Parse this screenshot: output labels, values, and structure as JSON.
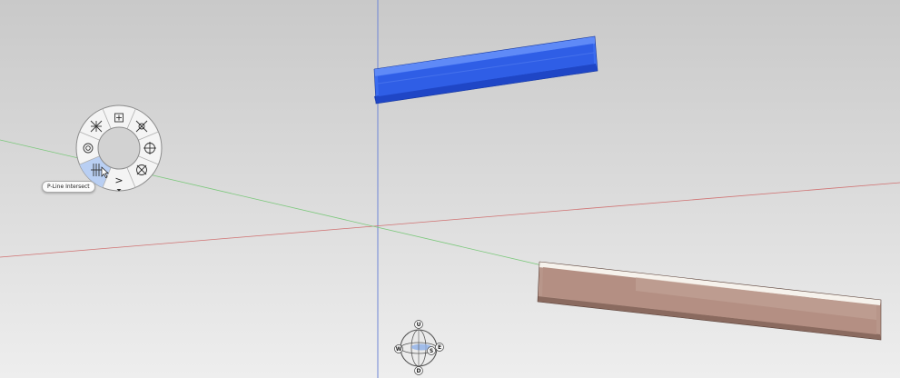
{
  "viewport": {
    "axis_colors": {
      "vertical": "#6f86d6",
      "red": "#d07272",
      "green": "#7bc87b"
    },
    "beams": [
      {
        "name": "blue-i-beam",
        "color": "#2f5ee6"
      },
      {
        "name": "brown-i-beam",
        "color": "#b8968a"
      }
    ]
  },
  "snap_wheel": {
    "items": [
      {
        "name": "center-snap-icon"
      },
      {
        "name": "tangent-snap-icon"
      },
      {
        "name": "quadrant-snap-icon"
      },
      {
        "name": "intersection-snap-icon"
      },
      {
        "name": "next-icon",
        "label": ">"
      },
      {
        "name": "p-line-intersect-icon"
      },
      {
        "name": "concentric-snap-icon"
      },
      {
        "name": "midpoint-snap-icon"
      }
    ],
    "active_item": "p-line-intersect-icon",
    "active_color": "#b9cff3",
    "tooltip": "P-Line Intersect"
  },
  "compass": {
    "labels": {
      "up": "U",
      "down": "D",
      "west": "W",
      "east": "E",
      "south": "S"
    }
  }
}
